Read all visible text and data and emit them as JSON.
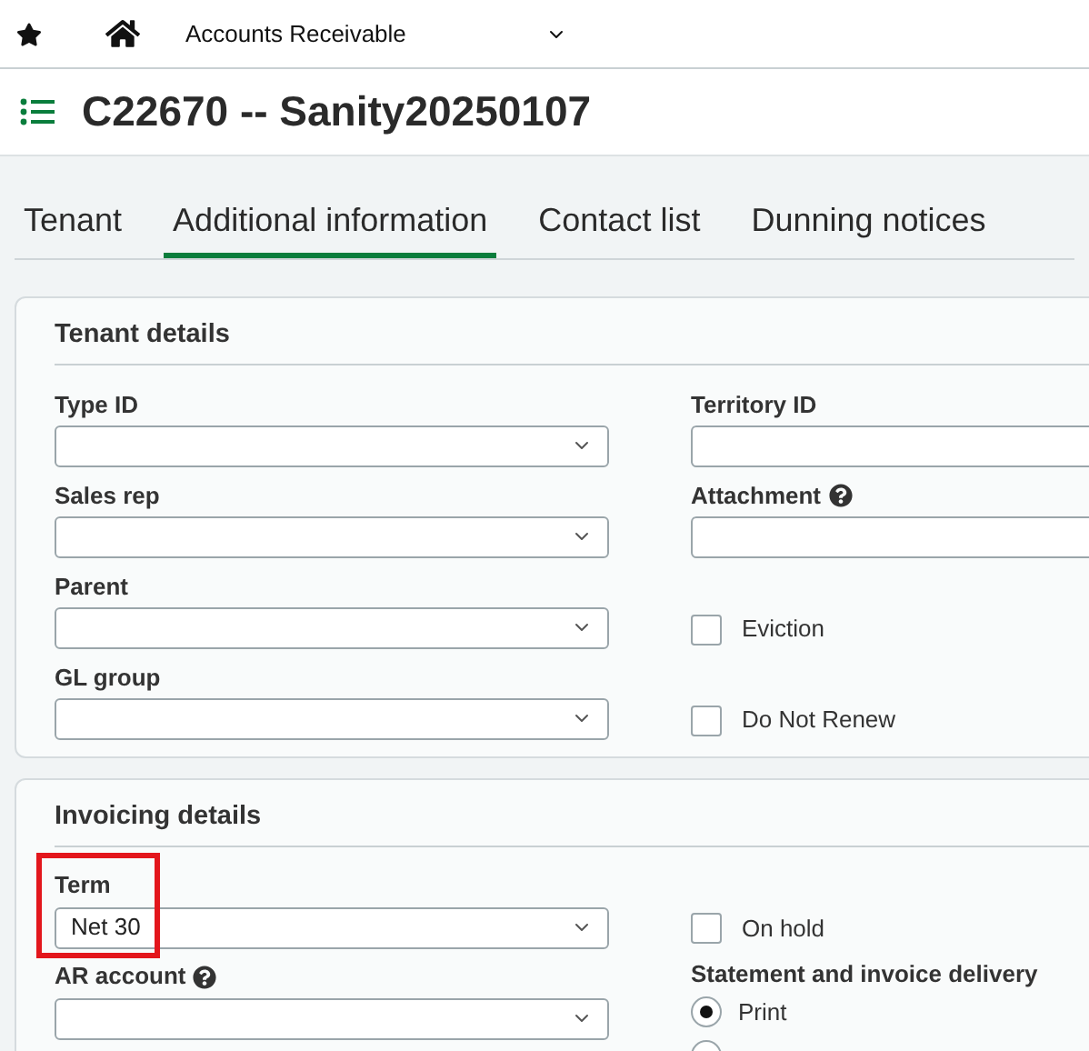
{
  "top_bar": {
    "module": "Accounts Receivable"
  },
  "page_title": "C22670 -- Sanity20250107",
  "tabs": [
    {
      "label": "Tenant",
      "selected": false
    },
    {
      "label": "Additional information",
      "selected": true
    },
    {
      "label": "Contact list",
      "selected": false
    },
    {
      "label": "Dunning notices",
      "selected": false
    }
  ],
  "sections": [
    {
      "title": "Tenant details",
      "rows": [
        {
          "left": {
            "kind": "select",
            "label": "Type ID"
          },
          "right": {
            "kind": "text",
            "label": "Territory ID"
          }
        },
        {
          "left": {
            "kind": "select",
            "label": "Sales rep"
          },
          "right": {
            "kind": "text",
            "label": "Attachment",
            "help": true
          }
        },
        {
          "left": {
            "kind": "select",
            "label": "Parent"
          },
          "right": {
            "kind": "checkbox",
            "label": "Eviction",
            "checked": false
          }
        },
        {
          "left": {
            "kind": "select",
            "label": "GL group"
          },
          "right": {
            "kind": "checkbox",
            "label": "Do Not Renew",
            "checked": false
          }
        }
      ]
    },
    {
      "title": "Invoicing details",
      "rows": [
        {
          "left": {
            "kind": "select",
            "label": "Term",
            "value": "Net 30",
            "highlighted": true
          },
          "right": {
            "kind": "checkbox",
            "label": "On hold",
            "checked": false
          }
        },
        {
          "left": {
            "kind": "select",
            "label": "AR account",
            "help": true
          },
          "right": {
            "kind": "radio",
            "label": "Statement and invoice delivery",
            "options": [
              {
                "label": "Print",
                "selected": true
              },
              {
                "selected": false
              }
            ]
          }
        }
      ]
    }
  ]
}
